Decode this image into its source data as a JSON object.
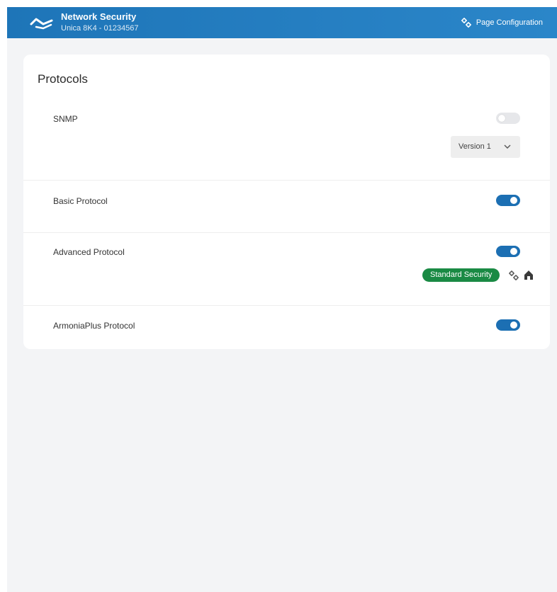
{
  "header": {
    "title": "Network Security",
    "subtitle": "Unica 8K4 - 01234567",
    "logo_icon": "wave-logo",
    "page_config_label": "Page Configuration",
    "page_config_icon": "gears-icon"
  },
  "protocols": {
    "title": "Protocols",
    "snmp": {
      "label": "SNMP",
      "enabled": false,
      "version": "Version 1"
    },
    "basic": {
      "label": "Basic Protocol",
      "enabled": true
    },
    "advanced": {
      "label": "Advanced Protocol",
      "enabled": true,
      "badge": "Standard Security",
      "actions": [
        "gears-icon",
        "home-icon"
      ]
    },
    "armonia": {
      "label": "ArmoniaPlus Protocol",
      "enabled": true
    }
  },
  "colors": {
    "header": "#1e75b8",
    "toggle_on": "#1c6fb3",
    "toggle_off": "#e6e7ea",
    "badge": "#1a8a44",
    "background": "#f3f4f6"
  }
}
